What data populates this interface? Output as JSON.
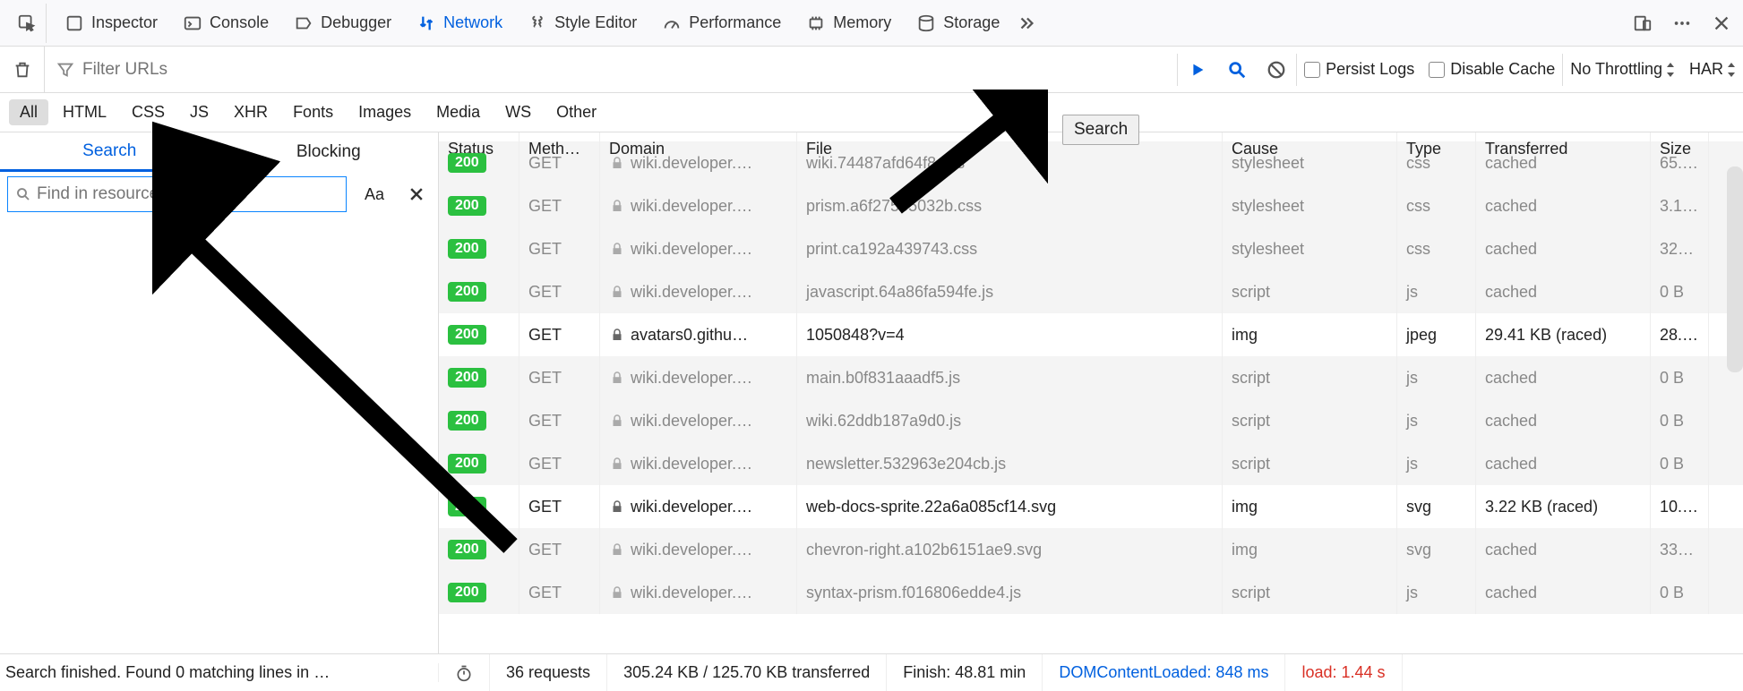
{
  "tabs": {
    "inspector": "Inspector",
    "console": "Console",
    "debugger": "Debugger",
    "network": "Network",
    "style_editor": "Style Editor",
    "performance": "Performance",
    "memory": "Memory",
    "storage": "Storage"
  },
  "filter_bar": {
    "placeholder": "Filter URLs",
    "persist_logs": "Persist Logs",
    "disable_cache": "Disable Cache",
    "throttling": "No Throttling",
    "har": "HAR"
  },
  "tooltip": "Search",
  "type_filters": [
    "All",
    "HTML",
    "CSS",
    "JS",
    "XHR",
    "Fonts",
    "Images",
    "Media",
    "WS",
    "Other"
  ],
  "side_tabs": {
    "search": "Search",
    "blocking": "Blocking"
  },
  "search_box": {
    "placeholder": "Find in resources…",
    "aa": "Aa"
  },
  "table_headers": {
    "status": "Status",
    "method": "Meth…",
    "domain": "Domain",
    "file": "File",
    "cause": "Cause",
    "type": "Type",
    "transferred": "Transferred",
    "size": "Size"
  },
  "rows": [
    {
      "status": "200",
      "method": "GET",
      "domain": "wiki.developer.…",
      "file": "wiki.74487afd64f8.css",
      "cause": "stylesheet",
      "type": "css",
      "transferred": "cached",
      "size": "65.…",
      "odd": false
    },
    {
      "status": "200",
      "method": "GET",
      "domain": "wiki.developer.…",
      "file": "prism.a6f275e5032b.css",
      "cause": "stylesheet",
      "type": "css",
      "transferred": "cached",
      "size": "3.1…",
      "odd": false
    },
    {
      "status": "200",
      "method": "GET",
      "domain": "wiki.developer.…",
      "file": "print.ca192a439743.css",
      "cause": "stylesheet",
      "type": "css",
      "transferred": "cached",
      "size": "32…",
      "odd": false
    },
    {
      "status": "200",
      "method": "GET",
      "domain": "wiki.developer.…",
      "file": "javascript.64a86fa594fe.js",
      "cause": "script",
      "type": "js",
      "transferred": "cached",
      "size": "0 B",
      "odd": false
    },
    {
      "status": "200",
      "method": "GET",
      "domain": "avatars0.githu…",
      "file": "1050848?v=4",
      "cause": "img",
      "type": "jpeg",
      "transferred": "29.41 KB (raced)",
      "size": "28.…",
      "odd": true
    },
    {
      "status": "200",
      "method": "GET",
      "domain": "wiki.developer.…",
      "file": "main.b0f831aaadf5.js",
      "cause": "script",
      "type": "js",
      "transferred": "cached",
      "size": "0 B",
      "odd": false
    },
    {
      "status": "200",
      "method": "GET",
      "domain": "wiki.developer.…",
      "file": "wiki.62ddb187a9d0.js",
      "cause": "script",
      "type": "js",
      "transferred": "cached",
      "size": "0 B",
      "odd": false
    },
    {
      "status": "200",
      "method": "GET",
      "domain": "wiki.developer.…",
      "file": "newsletter.532963e204cb.js",
      "cause": "script",
      "type": "js",
      "transferred": "cached",
      "size": "0 B",
      "odd": false
    },
    {
      "status": "200",
      "method": "GET",
      "domain": "wiki.developer.…",
      "file": "web-docs-sprite.22a6a085cf14.svg",
      "cause": "img",
      "type": "svg",
      "transferred": "3.22 KB (raced)",
      "size": "10.…",
      "odd": true
    },
    {
      "status": "200",
      "method": "GET",
      "domain": "wiki.developer.…",
      "file": "chevron-right.a102b6151ae9.svg",
      "cause": "img",
      "type": "svg",
      "transferred": "cached",
      "size": "33…",
      "odd": false
    },
    {
      "status": "200",
      "method": "GET",
      "domain": "wiki.developer.…",
      "file": "syntax-prism.f016806edde4.js",
      "cause": "script",
      "type": "js",
      "transferred": "cached",
      "size": "0 B",
      "odd": false
    }
  ],
  "status_bar": {
    "search_result": "Search finished. Found 0 matching lines in …",
    "requests": "36 requests",
    "transferred": "305.24 KB / 125.70 KB transferred",
    "finish": "Finish: 48.81 min",
    "dom": "DOMContentLoaded: 848 ms",
    "load": "load: 1.44 s"
  }
}
